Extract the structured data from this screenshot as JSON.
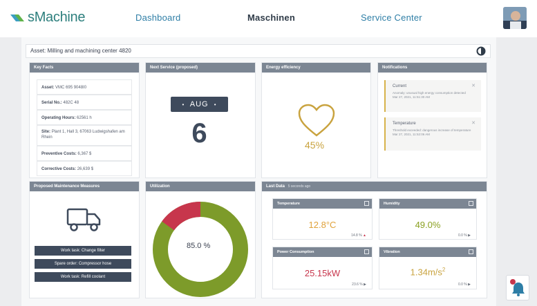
{
  "brand": {
    "name": "sMachine"
  },
  "nav": [
    {
      "label": "Dashboard",
      "active": false
    },
    {
      "label": "Maschinen",
      "active": true
    },
    {
      "label": "Service Center",
      "active": false
    }
  ],
  "asset": {
    "label": "Asset: Milling and machining center 4820"
  },
  "key_facts": {
    "title": "Key Facts",
    "rows": [
      {
        "label": "Asset:",
        "value": "VMC 695 9048I0"
      },
      {
        "label": "Serial No.:",
        "value": "482C 48"
      },
      {
        "label": "Operating Hours:",
        "value": "62561 h"
      },
      {
        "label": "Site:",
        "value": "Plant 1, Hall 3, 67063 Ludwigshafen am Rhein"
      },
      {
        "label": "Preventive Costs:",
        "value": "6,367 $"
      },
      {
        "label": "Corrective Costs:",
        "value": "26,639 $"
      }
    ]
  },
  "next_service": {
    "title": "Next Service (proposed)",
    "month": "AUG",
    "day": "6"
  },
  "energy": {
    "title": "Energy efficiency",
    "value": "45%",
    "color": "#c9a33f"
  },
  "notifications": {
    "title": "Notifications",
    "items": [
      {
        "title": "Current",
        "body": "Anomaly: unusual high energy consumption detected",
        "time": "Mar 27, 2021, 11:51:30 AM"
      },
      {
        "title": "Temperature",
        "body": "Threshold exceeded: dangerous increase of temperature",
        "time": "Mar 27, 2021, 11:52:06 AM"
      }
    ]
  },
  "maintenance": {
    "title": "Proposed Maintenance Measures",
    "buttons": [
      "Work task: Change filter",
      "Spare order: Compressor hose",
      "Work task: Refill coolant"
    ]
  },
  "utilization": {
    "title": "Utilization",
    "value_label": "85.0 %",
    "value": 85.0,
    "colors": {
      "used": "#7d9b2a",
      "rest": "#c7364c"
    }
  },
  "last_data": {
    "title": "Last Data",
    "subtitle": "5 seconds ago",
    "tiles": [
      {
        "title": "Temperature",
        "value": "12.8°C",
        "trend": "14.8 %",
        "trend_dir": "up",
        "color": "#e0a23a"
      },
      {
        "title": "Humidity",
        "value": "49.0%",
        "trend": "0.0 %",
        "trend_dir": "right",
        "color": "#8aa020"
      },
      {
        "title": "Power Consumption",
        "value": "25.15kW",
        "trend": "23.6 %",
        "trend_dir": "right",
        "color": "#c7364c"
      },
      {
        "title": "Vibration",
        "value": "1.34m/s",
        "value_sup": "2",
        "trend": "0.0 %",
        "trend_dir": "right",
        "color": "#c9a33f"
      }
    ]
  }
}
